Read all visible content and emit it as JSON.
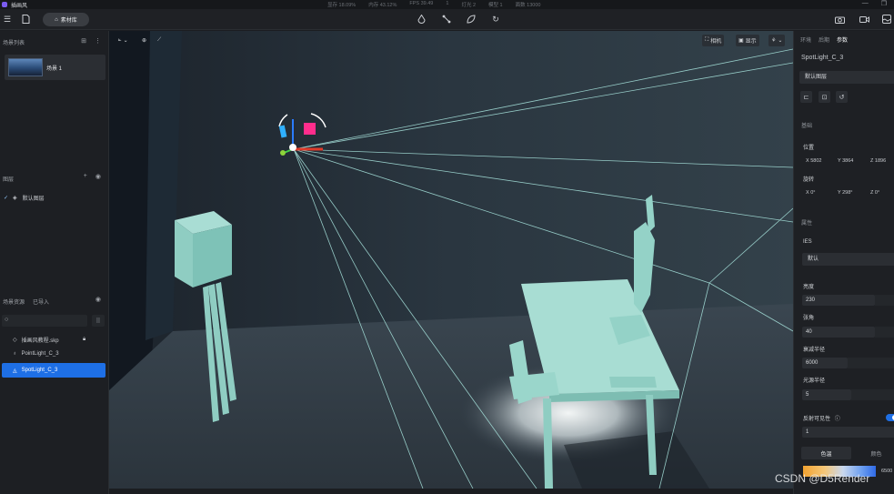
{
  "titlebar": {
    "app_title": "插画风",
    "stats": [
      "显存 18.09%",
      "内存 43.12%",
      "FPS 39.49",
      "1",
      "灯光 2",
      "模型 1",
      "面数 13000"
    ],
    "window_controls": [
      "—",
      "❐"
    ]
  },
  "toolbar": {
    "library_label": "素材库"
  },
  "left_panel": {
    "scene_list_title": "场景列表",
    "scene_name": "场景 1",
    "layers_title": "图层",
    "default_layer": "默认图层",
    "assets_tab": "场景资源",
    "imported_tab": "已导入",
    "search": {
      "placeholder": ""
    },
    "assets": [
      {
        "label": "插画风教程.skp",
        "icon": "model-icon"
      },
      {
        "label": "PointLight_C_3",
        "icon": "bulb-icon"
      },
      {
        "label": "SpotLight_C_3",
        "icon": "spotlight-icon"
      }
    ]
  },
  "viewport": {
    "camera_label": "相机",
    "display_label": "显示"
  },
  "right_panel": {
    "tabs": [
      "环境",
      "后期",
      "参数"
    ],
    "active_tab": "参数",
    "object_name": "SpotLight_C_3",
    "layer_select": "默认图层",
    "basic_section": "基础",
    "position_label": "位置",
    "position": {
      "x": "X 5802",
      "y": "Y 3864",
      "z": "Z 1896"
    },
    "rotation_label": "旋转",
    "rotation": {
      "x": "X 0°",
      "y": "Y 298°",
      "z": "Z 0°"
    },
    "attributes_section": "属性",
    "ies_label": "IES",
    "ies_value": "默认",
    "brightness_label": "亮度",
    "brightness_value": "230",
    "angle_label": "张角",
    "angle_value": "40",
    "falloff_label": "衰减半径",
    "falloff_value": "6000",
    "source_radius_label": "光源半径",
    "source_radius_value": "5",
    "reflect_label": "反射可见性",
    "reflect_value": "1",
    "color_temp_tab": "色温",
    "color_tab": "颜色",
    "color_temp_value": "6500"
  },
  "watermark": "CSDN @D5Render",
  "colors": {
    "accent": "#1e6fe5",
    "wireframe": "#9fe0d8",
    "model": "#7fc7b8"
  }
}
